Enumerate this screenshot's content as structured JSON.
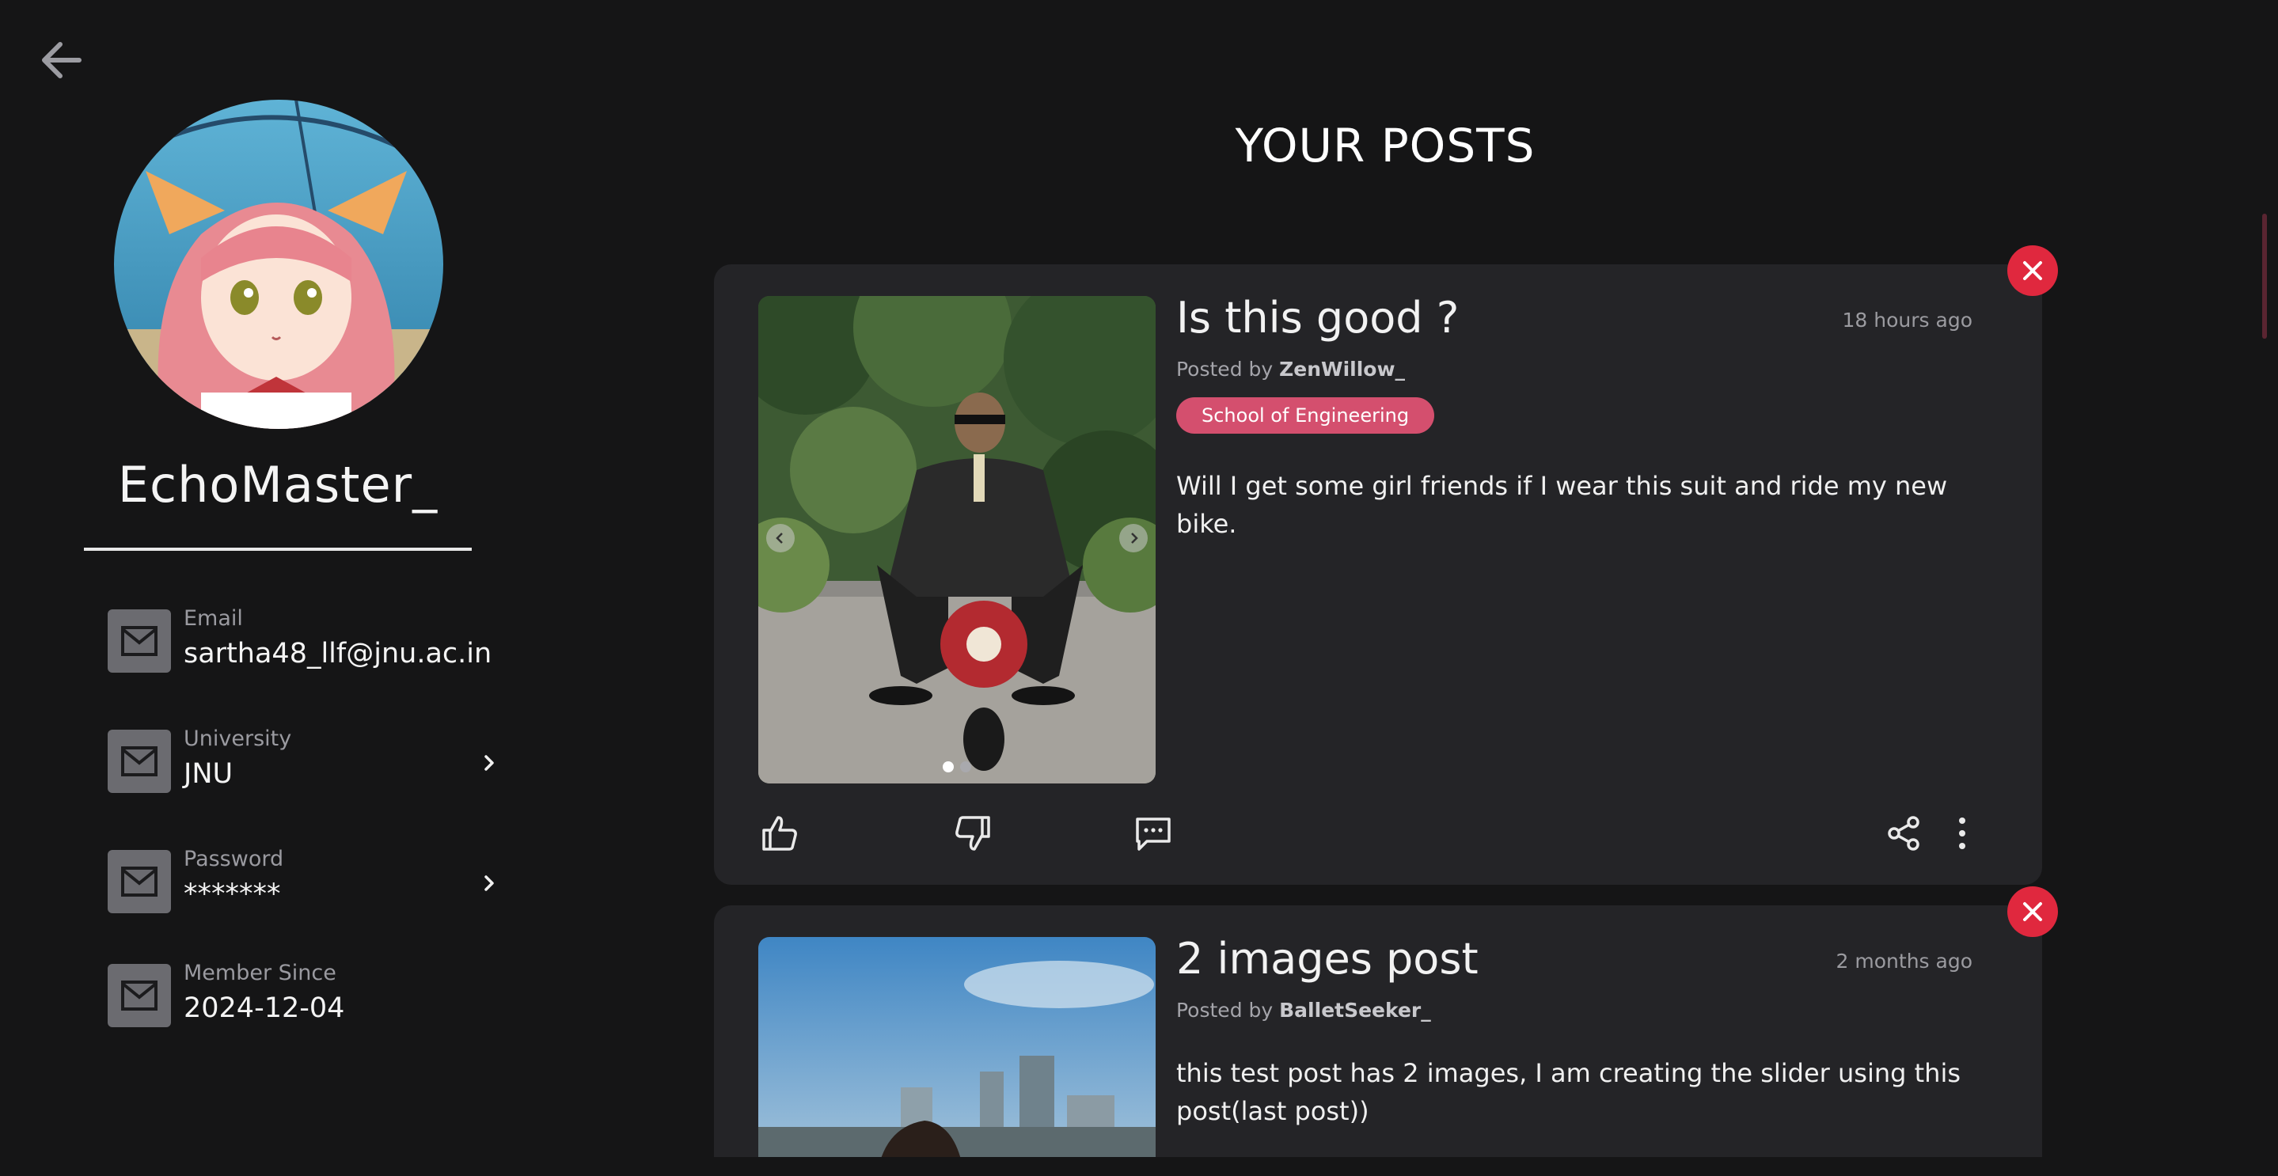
{
  "nav": {
    "back_icon": "arrow-left-icon"
  },
  "profile": {
    "username": "EchoMaster_",
    "fields": [
      {
        "label": "Email",
        "value": "sartha48_llf@jnu.ac.in",
        "icon": "mail-icon",
        "has_chevron": false
      },
      {
        "label": "University",
        "value": "JNU",
        "icon": "mail-icon",
        "has_chevron": true
      },
      {
        "label": "Password",
        "value": "*******",
        "icon": "mail-icon",
        "has_chevron": true
      },
      {
        "label": "Member Since",
        "value": "2024-12-04",
        "icon": "mail-icon",
        "has_chevron": false
      }
    ]
  },
  "main": {
    "title": "YOUR POSTS",
    "posts": [
      {
        "title": "Is this good ?",
        "time": "18 hours ago",
        "posted_by_prefix": "Posted by",
        "author": "ZenWillow_",
        "tag": "School of Engineering",
        "body": "Will I get some girl friends if I wear this suit and ride my new bike.",
        "image_count": 2,
        "active_image": 1
      },
      {
        "title": "2 images post",
        "time": "2 months ago",
        "posted_by_prefix": "Posted by",
        "author": "BalletSeeker_",
        "body": "this test post has 2 images, I am creating the slider using this post(last post))"
      }
    ]
  },
  "colors": {
    "background": "#151516",
    "card": "#242427",
    "tag": "#d44f6e",
    "delete": "#e0283e",
    "icon_box": "#6b6b70"
  }
}
